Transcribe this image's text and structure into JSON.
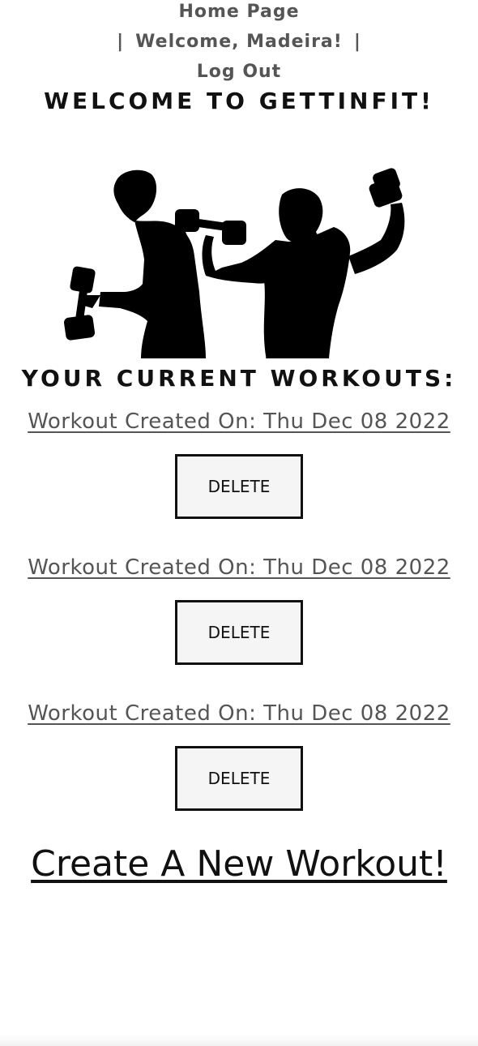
{
  "nav": {
    "home_label": "Home Page",
    "separator": "|",
    "welcome_label": "Welcome, Madeira!",
    "logout_label": "Log Out"
  },
  "header": {
    "title": "WELCOME TO GETTINFIT!"
  },
  "hero": {
    "image_name": "workout-silhouette"
  },
  "workouts": {
    "title": "YOUR CURRENT WORKOUTS:",
    "items": [
      {
        "label": "Workout Created On: Thu Dec 08 2022",
        "delete_label": "DELETE"
      },
      {
        "label": "Workout Created On: Thu Dec 08 2022",
        "delete_label": "DELETE"
      },
      {
        "label": "Workout Created On: Thu Dec 08 2022",
        "delete_label": "DELETE"
      }
    ]
  },
  "create": {
    "label": "Create A New Workout!"
  },
  "colors": {
    "text_dark": "#111111",
    "link_gray": "#555555",
    "button_bg": "#f5f5f5"
  }
}
